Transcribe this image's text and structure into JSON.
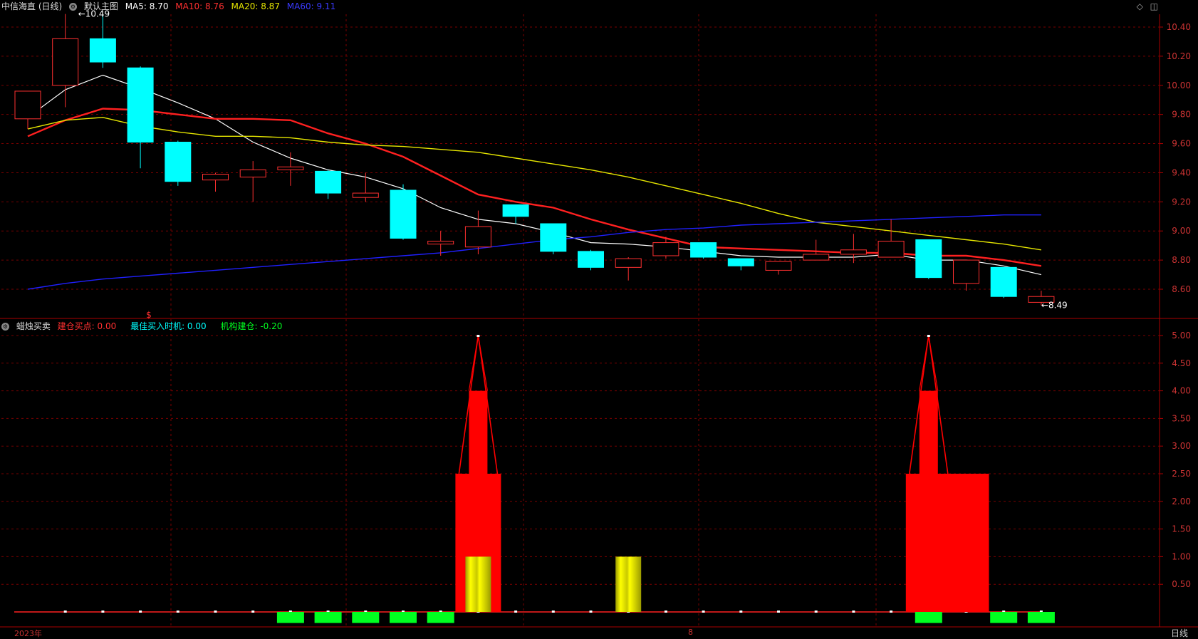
{
  "header": {
    "stock_name": "中信海直 (日线)",
    "template_label": "默认主图",
    "ma5": "MA5: 8.70",
    "ma10": "MA10: 8.76",
    "ma20": "MA20: 8.87",
    "ma60": "MA60: 9.11"
  },
  "indicator_header": {
    "name": "蜡烛买卖",
    "line1": "建仓买点: 0.00",
    "line2": "最佳买入时机: 0.00",
    "line3": "机构建仓: -0.20"
  },
  "colors": {
    "ma5": "#ffffff",
    "ma10": "#ff2020",
    "ma20": "#e6e600",
    "ma60": "#2020ff",
    "up": "#ff3030",
    "down": "#00ffff",
    "grid": "#7a0000",
    "axis_text": "#cc3333",
    "signal_red": "#ff0000",
    "signal_yellow": "#ffff00",
    "signal_green": "#00ff20"
  },
  "annotations": {
    "high_label": "10.49",
    "low_label": "8.49",
    "marker": "$"
  },
  "footer": {
    "year_label": "2023年",
    "month_label": "8",
    "period_label": "日线"
  },
  "chart_data": [
    {
      "type": "candlestick",
      "title": "中信海直 (日线)",
      "ylim": [
        8.45,
        10.5
      ],
      "yticks": [
        "10.40",
        "10.20",
        "10.00",
        "9.80",
        "9.60",
        "9.40",
        "9.20",
        "9.00",
        "8.80",
        "8.60"
      ],
      "candles": [
        {
          "o": 9.77,
          "h": 9.8,
          "l": 9.7,
          "c": 9.96
        },
        {
          "o": 10.0,
          "h": 10.49,
          "l": 9.85,
          "c": 10.32
        },
        {
          "o": 10.32,
          "h": 10.48,
          "l": 10.12,
          "c": 10.16
        },
        {
          "o": 10.12,
          "h": 10.13,
          "l": 9.43,
          "c": 9.61
        },
        {
          "o": 9.61,
          "h": 9.62,
          "l": 9.31,
          "c": 9.34
        },
        {
          "o": 9.35,
          "h": 9.4,
          "l": 9.27,
          "c": 9.39
        },
        {
          "o": 9.37,
          "h": 9.48,
          "l": 9.2,
          "c": 9.42
        },
        {
          "o": 9.42,
          "h": 9.54,
          "l": 9.31,
          "c": 9.44
        },
        {
          "o": 9.41,
          "h": 9.42,
          "l": 9.22,
          "c": 9.26
        },
        {
          "o": 9.23,
          "h": 9.4,
          "l": 9.2,
          "c": 9.26
        },
        {
          "o": 9.28,
          "h": 9.32,
          "l": 8.94,
          "c": 8.95
        },
        {
          "o": 8.91,
          "h": 9.0,
          "l": 8.83,
          "c": 8.93
        },
        {
          "o": 8.89,
          "h": 9.14,
          "l": 8.84,
          "c": 9.03
        },
        {
          "o": 9.18,
          "h": 9.18,
          "l": 9.05,
          "c": 9.1
        },
        {
          "o": 9.05,
          "h": 9.05,
          "l": 8.84,
          "c": 8.86
        },
        {
          "o": 8.86,
          "h": 8.87,
          "l": 8.73,
          "c": 8.75
        },
        {
          "o": 8.75,
          "h": 8.82,
          "l": 8.66,
          "c": 8.81
        },
        {
          "o": 8.83,
          "h": 8.96,
          "l": 8.81,
          "c": 8.92
        },
        {
          "o": 8.92,
          "h": 8.92,
          "l": 8.81,
          "c": 8.82
        },
        {
          "o": 8.81,
          "h": 8.81,
          "l": 8.73,
          "c": 8.76
        },
        {
          "o": 8.73,
          "h": 8.79,
          "l": 8.7,
          "c": 8.79
        },
        {
          "o": 8.8,
          "h": 8.94,
          "l": 8.8,
          "c": 8.84
        },
        {
          "o": 8.84,
          "h": 8.98,
          "l": 8.78,
          "c": 8.87
        },
        {
          "o": 8.82,
          "h": 9.08,
          "l": 8.82,
          "c": 8.93
        },
        {
          "o": 8.94,
          "h": 8.94,
          "l": 8.67,
          "c": 8.68
        },
        {
          "o": 8.64,
          "h": 8.79,
          "l": 8.59,
          "c": 8.8
        },
        {
          "o": 8.75,
          "h": 8.75,
          "l": 8.54,
          "c": 8.55
        },
        {
          "o": 8.51,
          "h": 8.59,
          "l": 8.49,
          "c": 8.55
        }
      ],
      "series": [
        {
          "name": "MA5",
          "values": [
            9.78,
            9.97,
            10.07,
            9.98,
            9.88,
            9.77,
            9.61,
            9.5,
            9.42,
            9.37,
            9.29,
            9.16,
            9.08,
            9.05,
            8.99,
            8.92,
            8.91,
            8.89,
            8.86,
            8.83,
            8.82,
            8.82,
            8.82,
            8.84,
            8.8,
            8.8,
            8.76,
            8.7
          ]
        },
        {
          "name": "MA10",
          "values": [
            9.65,
            9.76,
            9.84,
            9.83,
            9.8,
            9.77,
            9.77,
            9.76,
            9.67,
            9.6,
            9.51,
            9.38,
            9.25,
            9.2,
            9.16,
            9.08,
            9.01,
            8.95,
            8.89,
            8.88,
            8.87,
            8.86,
            8.85,
            8.85,
            8.83,
            8.83,
            8.8,
            8.76
          ]
        },
        {
          "name": "MA20",
          "values": [
            9.7,
            9.76,
            9.78,
            9.72,
            9.68,
            9.65,
            9.65,
            9.64,
            9.61,
            9.59,
            9.58,
            9.56,
            9.54,
            9.5,
            9.46,
            9.42,
            9.37,
            9.31,
            9.25,
            9.19,
            9.12,
            9.06,
            9.03,
            9.0,
            8.97,
            8.94,
            8.91,
            8.87
          ]
        },
        {
          "name": "MA60",
          "values": [
            8.6,
            8.64,
            8.67,
            8.69,
            8.71,
            8.73,
            8.75,
            8.77,
            8.79,
            8.81,
            8.83,
            8.85,
            8.88,
            8.91,
            8.94,
            8.96,
            8.99,
            9.01,
            9.02,
            9.04,
            9.05,
            9.06,
            9.07,
            9.08,
            9.09,
            9.1,
            9.11,
            9.11
          ]
        }
      ]
    },
    {
      "type": "bar",
      "title": "蜡烛买卖",
      "ylim": [
        -0.2,
        5.0
      ],
      "yticks": [
        "5.00",
        "4.50",
        "4.00",
        "3.50",
        "3.00",
        "2.50",
        "2.00",
        "1.50",
        "1.00",
        "0.50"
      ],
      "signal_red": [
        0,
        0,
        0,
        0,
        0,
        0,
        0,
        0,
        0,
        0,
        0,
        0,
        2.5,
        0,
        0,
        0,
        0,
        0,
        0,
        0,
        0,
        0,
        0,
        0,
        2.5,
        2.5,
        0,
        0
      ],
      "signal_red_high": [
        0,
        0,
        0,
        0,
        0,
        0,
        0,
        0,
        0,
        0,
        0,
        0,
        4.0,
        0,
        0,
        0,
        0,
        0,
        0,
        0,
        0,
        0,
        0,
        0,
        4.0,
        0,
        0,
        0
      ],
      "signal_peak": [
        0,
        0,
        0,
        0,
        0,
        0,
        0,
        0,
        0,
        0,
        0,
        0,
        5.0,
        0,
        0,
        0,
        0,
        0,
        0,
        0,
        0,
        0,
        0,
        0,
        5.0,
        0,
        0,
        0
      ],
      "signal_yellow": [
        0,
        0,
        0,
        0,
        0,
        0,
        0,
        0,
        0,
        0,
        0,
        0,
        1.0,
        0,
        0,
        0,
        1.0,
        0,
        0,
        0,
        0,
        0,
        0,
        0,
        0,
        0,
        0,
        0
      ],
      "signal_green": [
        0,
        0,
        0,
        0,
        0,
        0,
        0,
        -0.2,
        -0.2,
        -0.2,
        -0.2,
        -0.2,
        0,
        0,
        0,
        0,
        0,
        0,
        0,
        0,
        0,
        0,
        0,
        0,
        -0.2,
        0,
        -0.2,
        -0.2
      ]
    }
  ]
}
